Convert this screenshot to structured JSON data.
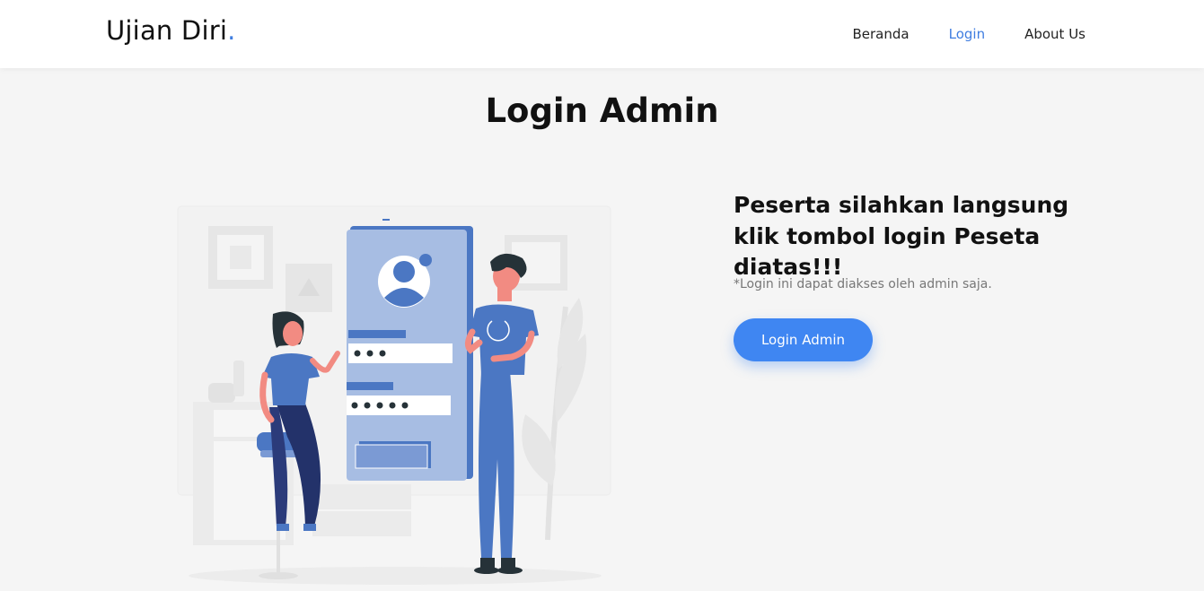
{
  "navbar": {
    "brand": "Ujian Diri",
    "brand_dot": ".",
    "links": [
      {
        "label": "Beranda",
        "active": false
      },
      {
        "label": "Login",
        "active": true
      },
      {
        "label": "About Us",
        "active": false
      }
    ]
  },
  "main": {
    "title": "Login Admin",
    "headline": "Peserta silahkan langsung klik tombol login Peseta diatas!!!",
    "note": "*Login ini dapat diakses oleh admin saja.",
    "button_label": "Login Admin"
  },
  "colors": {
    "accent": "#3f86f2",
    "active_link": "#3f7de0"
  },
  "illustration": {
    "icon": "login-illustration"
  }
}
